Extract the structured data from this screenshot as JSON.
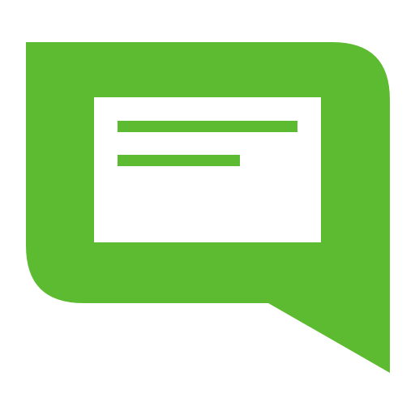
{
  "icon": {
    "name": "message-bubble-icon",
    "colors": {
      "bubble": "#5dbb31",
      "card": "#ffffff",
      "lines": "#5dbb31",
      "background": "#ffffff"
    }
  }
}
